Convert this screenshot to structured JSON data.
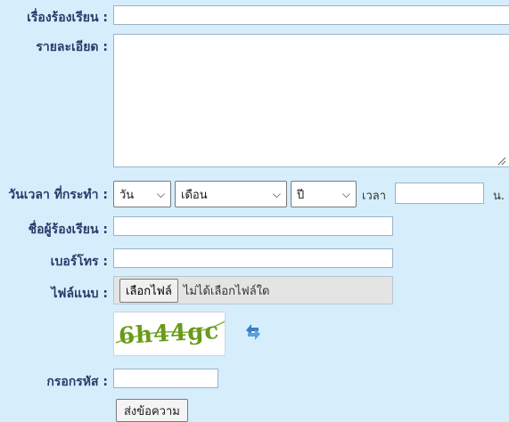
{
  "form": {
    "subject_label": "เรื่องร้องเรียน :",
    "detail_label": "รายละเอียด :",
    "datetime_label": "วันเวลา ที่กระทำ :",
    "day_select": "วัน",
    "month_select": "เดือน",
    "year_select": "ปี",
    "time_label": "เวลา",
    "time_unit": "น.",
    "name_label": "ชื่อผู้ร้องเรียน :",
    "phone_label": "เบอร์โทร :",
    "attach_label": "ไฟล์แนบ :",
    "file_button": "เลือกไฟล์",
    "file_status": "ไม่ได้เลือกไฟล์ใด",
    "captcha_text": "6h44gc",
    "code_label": "กรอกรหัส :",
    "submit_label": "ส่งข้อความ"
  },
  "colors": {
    "background": "#d6eefb",
    "label": "#2a3a6a",
    "captcha": "#6a9a1a",
    "refresh_icon": "#3a7fc0"
  },
  "icons": [
    "chevron-down-icon",
    "refresh-icon",
    "resize-grip-icon"
  ]
}
